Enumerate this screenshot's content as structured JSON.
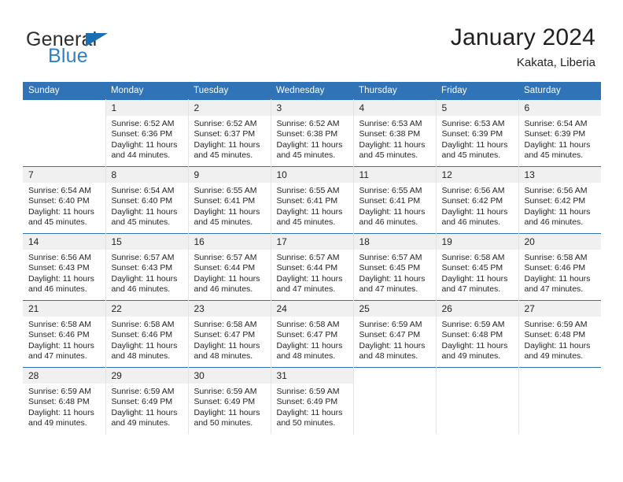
{
  "logo": {
    "word1": "General",
    "word2": "Blue",
    "triangle_color": "#1a6fb5",
    "word2_color": "#2f80c4"
  },
  "header": {
    "title": "January 2024",
    "location": "Kakata, Liberia"
  },
  "theme": {
    "header_blue": "#3073b7",
    "daynum_gray": "#f0f0f0",
    "text": "#231f20"
  },
  "weekday_headers": [
    "Sunday",
    "Monday",
    "Tuesday",
    "Wednesday",
    "Thursday",
    "Friday",
    "Saturday"
  ],
  "labels": {
    "sunrise": "Sunrise:",
    "sunset": "Sunset:",
    "daylight": "Daylight:"
  },
  "weeks": [
    [
      {
        "day": "",
        "sunrise": "",
        "sunset": "",
        "daylight": ""
      },
      {
        "day": "1",
        "sunrise": "Sunrise: 6:52 AM",
        "sunset": "Sunset: 6:36 PM",
        "daylight": "Daylight: 11 hours and 44 minutes."
      },
      {
        "day": "2",
        "sunrise": "Sunrise: 6:52 AM",
        "sunset": "Sunset: 6:37 PM",
        "daylight": "Daylight: 11 hours and 45 minutes."
      },
      {
        "day": "3",
        "sunrise": "Sunrise: 6:52 AM",
        "sunset": "Sunset: 6:38 PM",
        "daylight": "Daylight: 11 hours and 45 minutes."
      },
      {
        "day": "4",
        "sunrise": "Sunrise: 6:53 AM",
        "sunset": "Sunset: 6:38 PM",
        "daylight": "Daylight: 11 hours and 45 minutes."
      },
      {
        "day": "5",
        "sunrise": "Sunrise: 6:53 AM",
        "sunset": "Sunset: 6:39 PM",
        "daylight": "Daylight: 11 hours and 45 minutes."
      },
      {
        "day": "6",
        "sunrise": "Sunrise: 6:54 AM",
        "sunset": "Sunset: 6:39 PM",
        "daylight": "Daylight: 11 hours and 45 minutes."
      }
    ],
    [
      {
        "day": "7",
        "sunrise": "Sunrise: 6:54 AM",
        "sunset": "Sunset: 6:40 PM",
        "daylight": "Daylight: 11 hours and 45 minutes."
      },
      {
        "day": "8",
        "sunrise": "Sunrise: 6:54 AM",
        "sunset": "Sunset: 6:40 PM",
        "daylight": "Daylight: 11 hours and 45 minutes."
      },
      {
        "day": "9",
        "sunrise": "Sunrise: 6:55 AM",
        "sunset": "Sunset: 6:41 PM",
        "daylight": "Daylight: 11 hours and 45 minutes."
      },
      {
        "day": "10",
        "sunrise": "Sunrise: 6:55 AM",
        "sunset": "Sunset: 6:41 PM",
        "daylight": "Daylight: 11 hours and 45 minutes."
      },
      {
        "day": "11",
        "sunrise": "Sunrise: 6:55 AM",
        "sunset": "Sunset: 6:41 PM",
        "daylight": "Daylight: 11 hours and 46 minutes."
      },
      {
        "day": "12",
        "sunrise": "Sunrise: 6:56 AM",
        "sunset": "Sunset: 6:42 PM",
        "daylight": "Daylight: 11 hours and 46 minutes."
      },
      {
        "day": "13",
        "sunrise": "Sunrise: 6:56 AM",
        "sunset": "Sunset: 6:42 PM",
        "daylight": "Daylight: 11 hours and 46 minutes."
      }
    ],
    [
      {
        "day": "14",
        "sunrise": "Sunrise: 6:56 AM",
        "sunset": "Sunset: 6:43 PM",
        "daylight": "Daylight: 11 hours and 46 minutes."
      },
      {
        "day": "15",
        "sunrise": "Sunrise: 6:57 AM",
        "sunset": "Sunset: 6:43 PM",
        "daylight": "Daylight: 11 hours and 46 minutes."
      },
      {
        "day": "16",
        "sunrise": "Sunrise: 6:57 AM",
        "sunset": "Sunset: 6:44 PM",
        "daylight": "Daylight: 11 hours and 46 minutes."
      },
      {
        "day": "17",
        "sunrise": "Sunrise: 6:57 AM",
        "sunset": "Sunset: 6:44 PM",
        "daylight": "Daylight: 11 hours and 47 minutes."
      },
      {
        "day": "18",
        "sunrise": "Sunrise: 6:57 AM",
        "sunset": "Sunset: 6:45 PM",
        "daylight": "Daylight: 11 hours and 47 minutes."
      },
      {
        "day": "19",
        "sunrise": "Sunrise: 6:58 AM",
        "sunset": "Sunset: 6:45 PM",
        "daylight": "Daylight: 11 hours and 47 minutes."
      },
      {
        "day": "20",
        "sunrise": "Sunrise: 6:58 AM",
        "sunset": "Sunset: 6:46 PM",
        "daylight": "Daylight: 11 hours and 47 minutes."
      }
    ],
    [
      {
        "day": "21",
        "sunrise": "Sunrise: 6:58 AM",
        "sunset": "Sunset: 6:46 PM",
        "daylight": "Daylight: 11 hours and 47 minutes."
      },
      {
        "day": "22",
        "sunrise": "Sunrise: 6:58 AM",
        "sunset": "Sunset: 6:46 PM",
        "daylight": "Daylight: 11 hours and 48 minutes."
      },
      {
        "day": "23",
        "sunrise": "Sunrise: 6:58 AM",
        "sunset": "Sunset: 6:47 PM",
        "daylight": "Daylight: 11 hours and 48 minutes."
      },
      {
        "day": "24",
        "sunrise": "Sunrise: 6:58 AM",
        "sunset": "Sunset: 6:47 PM",
        "daylight": "Daylight: 11 hours and 48 minutes."
      },
      {
        "day": "25",
        "sunrise": "Sunrise: 6:59 AM",
        "sunset": "Sunset: 6:47 PM",
        "daylight": "Daylight: 11 hours and 48 minutes."
      },
      {
        "day": "26",
        "sunrise": "Sunrise: 6:59 AM",
        "sunset": "Sunset: 6:48 PM",
        "daylight": "Daylight: 11 hours and 49 minutes."
      },
      {
        "day": "27",
        "sunrise": "Sunrise: 6:59 AM",
        "sunset": "Sunset: 6:48 PM",
        "daylight": "Daylight: 11 hours and 49 minutes."
      }
    ],
    [
      {
        "day": "28",
        "sunrise": "Sunrise: 6:59 AM",
        "sunset": "Sunset: 6:48 PM",
        "daylight": "Daylight: 11 hours and 49 minutes."
      },
      {
        "day": "29",
        "sunrise": "Sunrise: 6:59 AM",
        "sunset": "Sunset: 6:49 PM",
        "daylight": "Daylight: 11 hours and 49 minutes."
      },
      {
        "day": "30",
        "sunrise": "Sunrise: 6:59 AM",
        "sunset": "Sunset: 6:49 PM",
        "daylight": "Daylight: 11 hours and 50 minutes."
      },
      {
        "day": "31",
        "sunrise": "Sunrise: 6:59 AM",
        "sunset": "Sunset: 6:49 PM",
        "daylight": "Daylight: 11 hours and 50 minutes."
      },
      {
        "day": "",
        "sunrise": "",
        "sunset": "",
        "daylight": ""
      },
      {
        "day": "",
        "sunrise": "",
        "sunset": "",
        "daylight": ""
      },
      {
        "day": "",
        "sunrise": "",
        "sunset": "",
        "daylight": ""
      }
    ]
  ]
}
